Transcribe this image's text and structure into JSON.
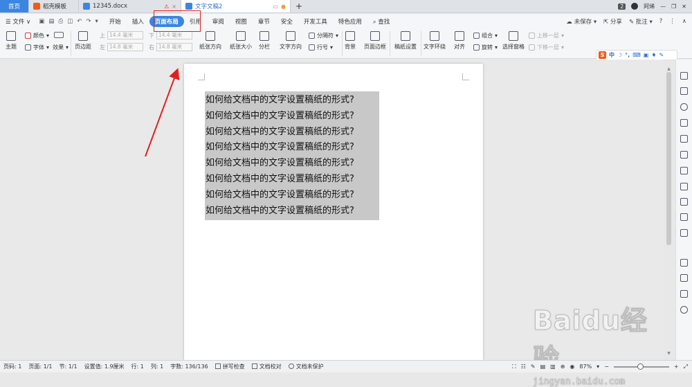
{
  "tabs": [
    {
      "label": "首页",
      "color": "#3b86e0"
    },
    {
      "label": "稻壳模板",
      "color": "#f25a1a"
    },
    {
      "label": "12345.docx",
      "color": "#3b86e0"
    },
    {
      "label": "文字文稿2",
      "color": "#3b86e0"
    }
  ],
  "tab_add": "+",
  "topright": {
    "badge": "2",
    "user": "阿烯"
  },
  "menu": {
    "file": "文件",
    "items": [
      "开始",
      "插入",
      "页面布局",
      "引用",
      "审阅",
      "视图",
      "章节",
      "安全",
      "开发工具",
      "特色应用"
    ],
    "active": "页面布局",
    "search": "查找",
    "unsaved": "未保存",
    "share": "分享",
    "comment": "批注"
  },
  "ribbon": {
    "theme": "主题",
    "color": "颜色",
    "font": "字体",
    "effect": "效果",
    "margin": "页边距",
    "top_label": "上",
    "top_val": "14.4 毫米",
    "bottom_label": "下",
    "bottom_val": "14.4 毫米",
    "left_label": "左",
    "left_val": "14.8 毫米",
    "right_label": "右",
    "right_val": "14.8 毫米",
    "orientation": "纸张方向",
    "size": "纸张大小",
    "columns": "分栏",
    "text_dir": "文字方向",
    "separator": "分隔符",
    "line_num": "行号",
    "background": "背景",
    "page_border": "页面边框",
    "manuscript": "稿纸设置",
    "wrap": "文字环绕",
    "align": "对齐",
    "group": "组合",
    "rotate": "旋转",
    "select_pane": "选择窗格",
    "bring_fwd": "上移一层",
    "send_back": "下移一层"
  },
  "sogou": {
    "logo": "S",
    "lang": "中"
  },
  "document": {
    "lines": [
      "如何给文档中的文字设置稿纸的形式?",
      "如何给文档中的文字设置稿纸的形式?",
      "如何给文档中的文字设置稿纸的形式?",
      "如何给文档中的文字设置稿纸的形式?",
      "如何给文档中的文字设置稿纸的形式?",
      "如何给文档中的文字设置稿纸的形式?",
      "如何给文档中的文字设置稿纸的形式?",
      "如何给文档中的文字设置稿纸的形式?"
    ]
  },
  "status": {
    "page": "页码: 1",
    "pages": "页面: 1/1",
    "section": "节: 1/1",
    "setting": "设置值: 1.9厘米",
    "row": "行: 1",
    "col": "列: 1",
    "words": "字数: 136/136",
    "spell": "拼写检查",
    "proof": "文档校对",
    "protect": "文档未保护",
    "zoom": "87%"
  },
  "watermark": {
    "big": "Baidu经验",
    "small": "jingyan.baidu.com"
  },
  "colors": {
    "accent": "#3b86e0",
    "annotation": "#e02020"
  }
}
